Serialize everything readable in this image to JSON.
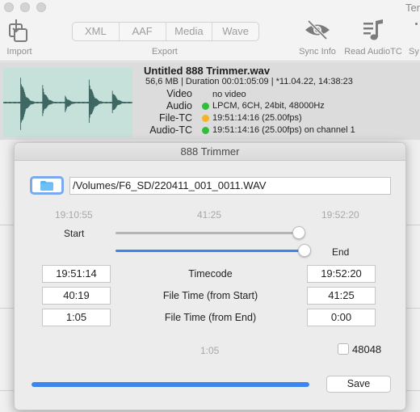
{
  "window": {
    "title_partial": "Ter"
  },
  "toolbar": {
    "import_label": "Import",
    "export_segments": [
      "XML",
      "AAF",
      "Media",
      "Wave"
    ],
    "export_label": "Export",
    "sync_info_label": "Sync Info",
    "read_audiotc_label": "Read AudioTC",
    "partial_label": "Sy"
  },
  "file_info": {
    "title": "Untitled 888 Trimmer.wav",
    "meta": "56,6 MB | Duration 00:01:05:09 | *11.04.22, 14:38:23",
    "rows": [
      {
        "label": "Video",
        "value": "no video",
        "status": "none"
      },
      {
        "label": "Audio",
        "value": "LPCM, 6CH, 24bit, 48000Hz",
        "status": "green"
      },
      {
        "label": "File-TC",
        "value": "19:51:14:16 (25.00fps)",
        "status": "orange"
      },
      {
        "label": "Audio-TC",
        "value": "19:51:14:16 (25.00fps) on channel 1",
        "status": "green"
      }
    ],
    "status_colors": {
      "green": "#2fbf3d",
      "orange": "#f5b325"
    }
  },
  "dialog": {
    "title": "888 Trimmer",
    "path": "/Volumes/F6_SD/220411_001_0011.WAV",
    "range_start_time": "19:10:55",
    "range_duration": "41:25",
    "range_end_time": "19:52:20",
    "start_label": "Start",
    "end_label": "End",
    "start_slider_fraction": 0.97,
    "end_slider_fraction": 1.0,
    "rows": [
      {
        "label": "Timecode",
        "start": "19:51:14",
        "end": "19:52:20"
      },
      {
        "label": "File Time (from Start)",
        "start": "40:19",
        "end": "41:25"
      },
      {
        "label": "File Time (from End)",
        "start": "1:05",
        "end": "0:00"
      }
    ],
    "selection_duration": "1:05",
    "checkbox_label": "48048",
    "checkbox_checked": false,
    "progress_percent": 100,
    "save_label": "Save",
    "accent_color": "#3b86ee"
  }
}
